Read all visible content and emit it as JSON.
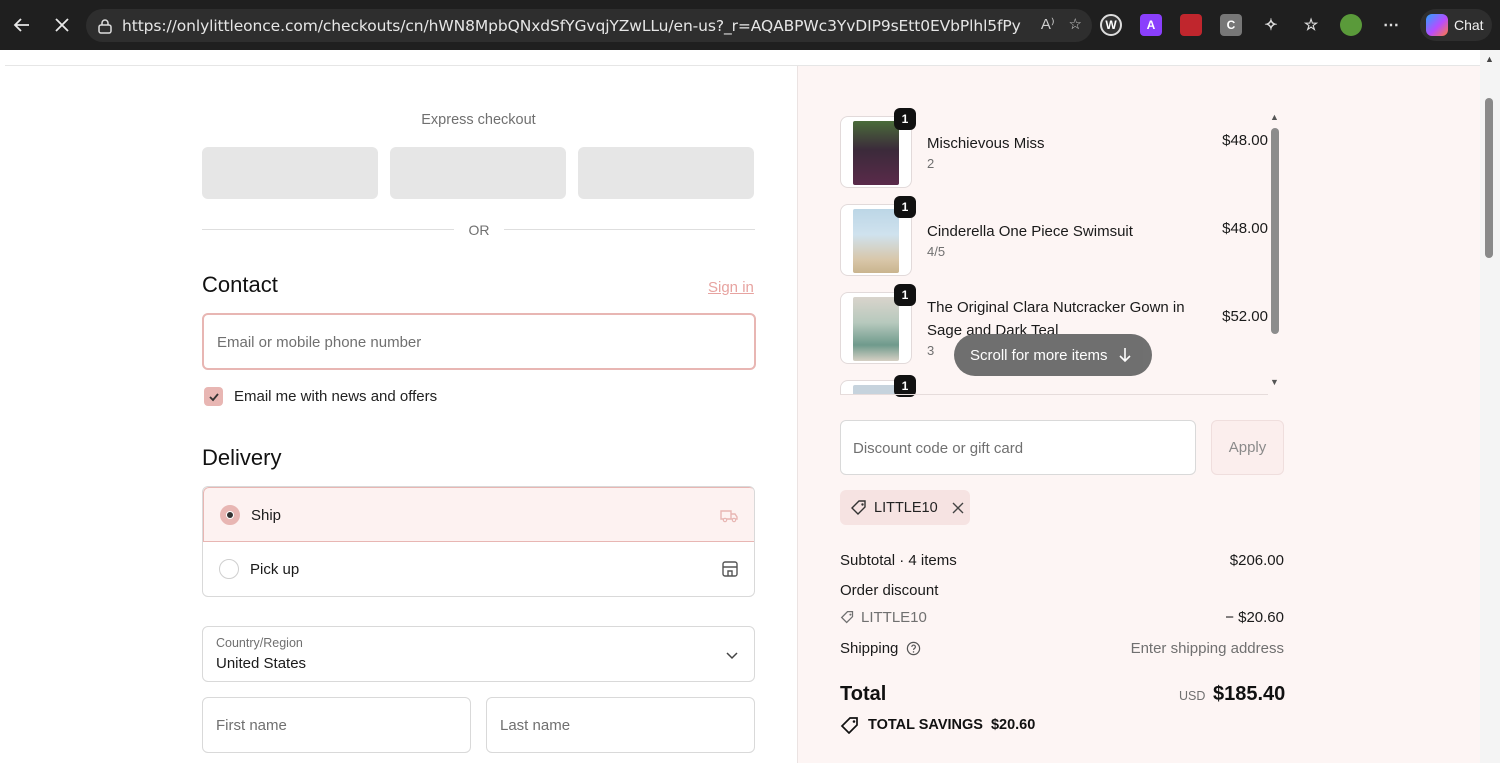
{
  "browser": {
    "url": "https://onlylittleonce.com/checkouts/cn/hWN8MpbQNxdSfYGvqjYZwLLu/en-us?_r=AQABPWc3YvDIP9sEtt0EVbPlhl5fPyRpvKbKKHx...",
    "chat_label": "Chat"
  },
  "checkout": {
    "express_label": "Express checkout",
    "or_text": "OR",
    "contact_heading": "Contact",
    "sign_in": "Sign in",
    "email_placeholder": "Email or mobile phone number",
    "newsletter_label": "Email me with news and offers",
    "newsletter_checked": true,
    "delivery_heading": "Delivery",
    "delivery_options": [
      {
        "label": "Ship",
        "selected": true
      },
      {
        "label": "Pick up",
        "selected": false
      }
    ],
    "country_label": "Country/Region",
    "country_value": "United States",
    "first_name_placeholder": "First name",
    "last_name_placeholder": "Last name"
  },
  "summary": {
    "items": [
      {
        "name": "Mischievous Miss",
        "variant": "2",
        "price": "$48.00",
        "qty": "1"
      },
      {
        "name": "Cinderella One Piece Swimsuit",
        "variant": "4/5",
        "price": "$48.00",
        "qty": "1"
      },
      {
        "name": "The Original Clara Nutcracker Gown in Sage and Dark Teal",
        "variant": "3",
        "price": "$52.00",
        "qty": "1"
      },
      {
        "qty": "1"
      }
    ],
    "scroll_hint": "Scroll for more items",
    "discount_placeholder": "Discount code or gift card",
    "apply_label": "Apply",
    "applied_code": "LITTLE10",
    "subtotal_label": "Subtotal · 4 items",
    "subtotal_value": "$206.00",
    "order_discount_label": "Order discount",
    "discount_code": "LITTLE10",
    "discount_value": "− $20.60",
    "shipping_label": "Shipping",
    "shipping_value": "Enter shipping address",
    "total_label": "Total",
    "currency": "USD",
    "total_value": "$185.40",
    "savings_label": "TOTAL SAVINGS",
    "savings_value": "$20.60"
  }
}
